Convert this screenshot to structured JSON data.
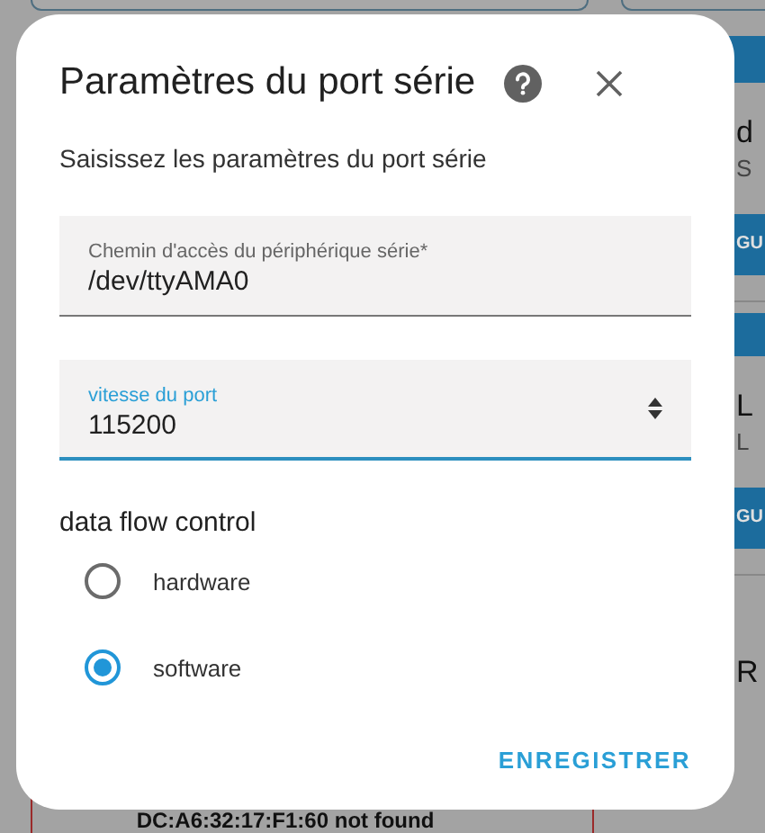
{
  "background": {
    "side_texts": [
      {
        "kind": "heading",
        "text": "d"
      },
      {
        "kind": "sub",
        "text": "S"
      },
      {
        "kind": "button",
        "text": "GU"
      },
      {
        "kind": "bar"
      },
      {
        "kind": "heading",
        "text": "L"
      },
      {
        "kind": "sub",
        "text": "L"
      },
      {
        "kind": "button",
        "text": "GU"
      },
      {
        "kind": "heading2",
        "text": "R"
      }
    ],
    "bottom_card_text": "DC:A6:32:17:F1:60 not found"
  },
  "dialog": {
    "title": "Paramètres du port série",
    "subtitle": "Saisissez les paramètres du port série",
    "fields": [
      {
        "label": "Chemin d'accès du périphérique série*",
        "value": "/dev/ttyAMA0",
        "focused": false,
        "kind": "text"
      },
      {
        "label": "vitesse du port",
        "value": "115200",
        "focused": true,
        "kind": "number"
      }
    ],
    "radio_group": {
      "label": "data flow control",
      "options": [
        {
          "label": "hardware",
          "selected": false
        },
        {
          "label": "software",
          "selected": true
        }
      ]
    },
    "buttons": [
      "ENREGISTRER"
    ]
  }
}
